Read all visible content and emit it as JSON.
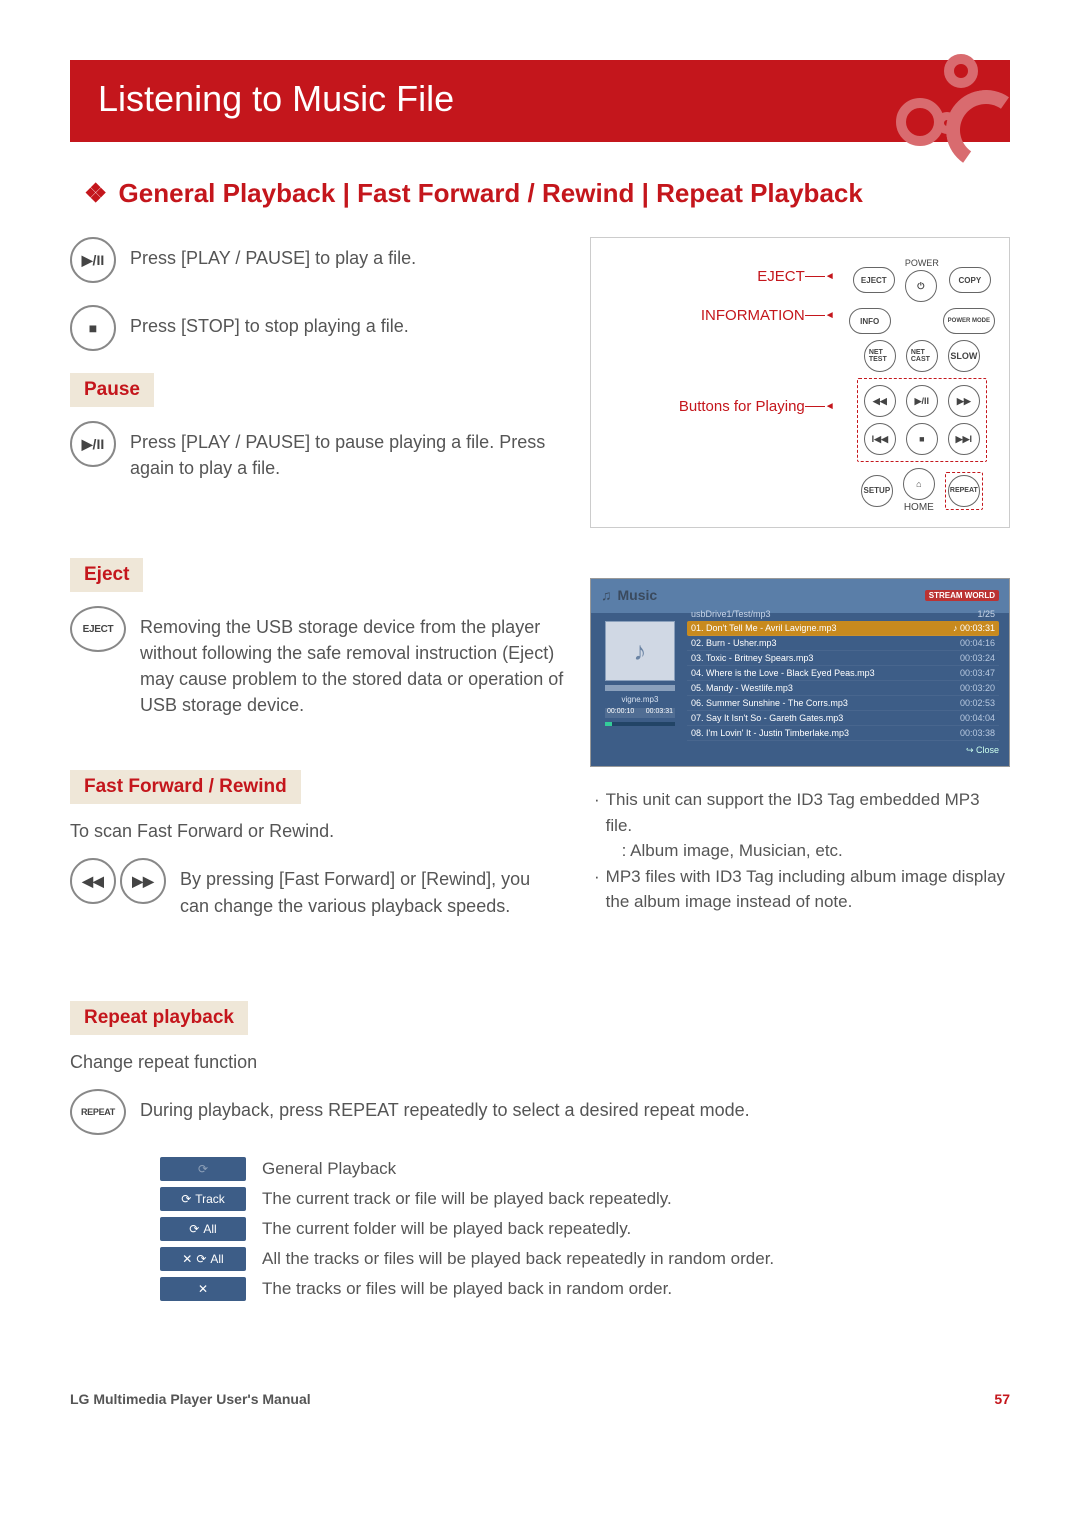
{
  "header": {
    "title": "Listening to Music File"
  },
  "subheading": "General Playback | Fast Forward / Rewind | Repeat Playback",
  "playback": {
    "play_text": "Press [PLAY / PAUSE] to play a file.",
    "stop_text": "Press [STOP] to stop playing a file."
  },
  "pause": {
    "label": "Pause",
    "text": "Press [PLAY / PAUSE] to pause playing a file. Press again to play a file."
  },
  "eject": {
    "label": "Eject",
    "btn": "EJECT",
    "text1": "Removing the USB storage device from the player without following the safe removal instruction (Eject)",
    "text2": "may cause problem to the stored data or operation of USB storage device."
  },
  "ff": {
    "label": "Fast Forward / Rewind",
    "intro": "To scan Fast Forward or Rewind.",
    "text": "By pressing [Fast Forward] or [Rewind], you can change the various playback speeds."
  },
  "repeat": {
    "label": "Repeat playback",
    "intro": "Change repeat function",
    "btn": "REPEAT",
    "text": "During playback, press REPEAT repeatedly to select a desired repeat mode.",
    "modes": [
      {
        "chip": "",
        "desc": "General Playback"
      },
      {
        "chip": "Track",
        "desc": "The current track or file will be played back repeatedly."
      },
      {
        "chip": "All",
        "desc": "The current folder will be played back repeatedly."
      },
      {
        "chip": "All",
        "desc": "All the tracks or files will be played back repeatedly in random order."
      },
      {
        "chip": "",
        "desc": "The tracks or files will be played back in random order."
      }
    ]
  },
  "remote": {
    "eject_label": "EJECT",
    "info_label": "INFORMATION",
    "play_label": "Buttons for Playing",
    "power": "POWER",
    "home": "HOME",
    "buttons": {
      "eject": "EJECT",
      "copy": "COPY",
      "info": "INFO",
      "power_mode": "POWER MODE",
      "net_test": "NET TEST",
      "net_cast": "NET CAST",
      "slow": "SLOW",
      "setup": "SETUP",
      "repeat": "REPEAT"
    }
  },
  "music_screen": {
    "title": "Music",
    "badge": "STREAM WORLD",
    "path": "usbDrive1/Test/mp3",
    "count": "1/25",
    "album_name": "vigne.mp3",
    "time_left": "00:00:10",
    "time_right": "00:03:31",
    "tracks": [
      {
        "name": "01. Don't Tell Me - Avril Lavigne.mp3",
        "dur": "00:03:31",
        "sel": true
      },
      {
        "name": "02. Burn - Usher.mp3",
        "dur": "00:04:16"
      },
      {
        "name": "03. Toxic - Britney Spears.mp3",
        "dur": "00:03:24"
      },
      {
        "name": "04. Where is the Love - Black Eyed Peas.mp3",
        "dur": "00:03:47"
      },
      {
        "name": "05. Mandy - Westlife.mp3",
        "dur": "00:03:20"
      },
      {
        "name": "06. Summer Sunshine - The Corrs.mp3",
        "dur": "00:02:53"
      },
      {
        "name": "07. Say It Isn't So - Gareth Gates.mp3",
        "dur": "00:04:04"
      },
      {
        "name": "08. I'm Lovin' It - Justin Timberlake.mp3",
        "dur": "00:03:38"
      }
    ],
    "close": "Close"
  },
  "notes": {
    "n1a": "This unit can support the ID3 Tag embedded MP3 file.",
    "n1b": ": Album image, Musician, etc.",
    "n2": "MP3 files with ID3 Tag including album image display the album image instead of note."
  },
  "footer": {
    "left": "LG Multimedia Player User's Manual",
    "page": "57"
  }
}
